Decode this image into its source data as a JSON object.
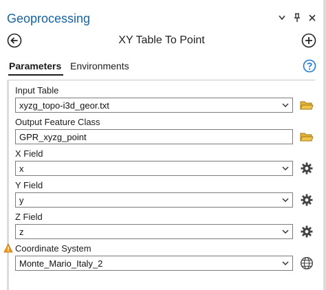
{
  "app": {
    "title": "Geoprocessing"
  },
  "tool": {
    "title": "XY Table To Point"
  },
  "icons": {
    "options": "chevron-down-icon",
    "pin": "pin-icon",
    "close": "close-icon",
    "back": "back-arrow-icon",
    "add": "add-circle-icon",
    "help": "help-icon",
    "folder": "folder-icon",
    "gear": "gear-icon",
    "globe": "globe-icon",
    "warning": "warning-icon"
  },
  "colors": {
    "title": "#1463a5",
    "help": "#1e7bd6",
    "folder": "#c79a1a",
    "warning": "#f29a1c"
  },
  "tabs": [
    {
      "label": "Parameters",
      "active": true
    },
    {
      "label": "Environments",
      "active": false
    }
  ],
  "params": [
    {
      "label": "Input Table",
      "value": "xyzg_topo-i3d_geor.txt",
      "button": "folder"
    },
    {
      "label": "Output Feature Class",
      "value": "GPR_xyzg_point",
      "button": "folder"
    },
    {
      "label": "X Field",
      "value": "x",
      "button": "gear"
    },
    {
      "label": "Y Field",
      "value": "y",
      "button": "gear"
    },
    {
      "label": "Z Field",
      "value": "z",
      "button": "gear"
    },
    {
      "label": "Coordinate System",
      "value": "Monte_Mario_Italy_2",
      "button": "globe",
      "warning": true
    }
  ]
}
